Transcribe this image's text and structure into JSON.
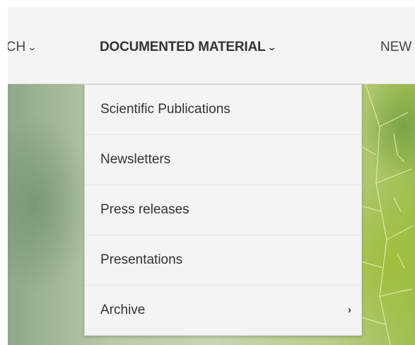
{
  "nav": {
    "items": [
      {
        "label": "RCH",
        "chevron": "⌄"
      },
      {
        "label": "DOCUMENTED MATERIAL",
        "chevron": "⌄"
      },
      {
        "label": "NEW"
      }
    ]
  },
  "dropdown": {
    "items": [
      {
        "label": "Scientific Publications"
      },
      {
        "label": "Newsletters"
      },
      {
        "label": "Press releases"
      },
      {
        "label": "Presentations"
      },
      {
        "label": "Archive",
        "submenu_icon": "›"
      }
    ]
  },
  "colors": {
    "nav_background": "#f4f4f4",
    "dropdown_background": "#f4f4f4",
    "text": "#333333"
  }
}
